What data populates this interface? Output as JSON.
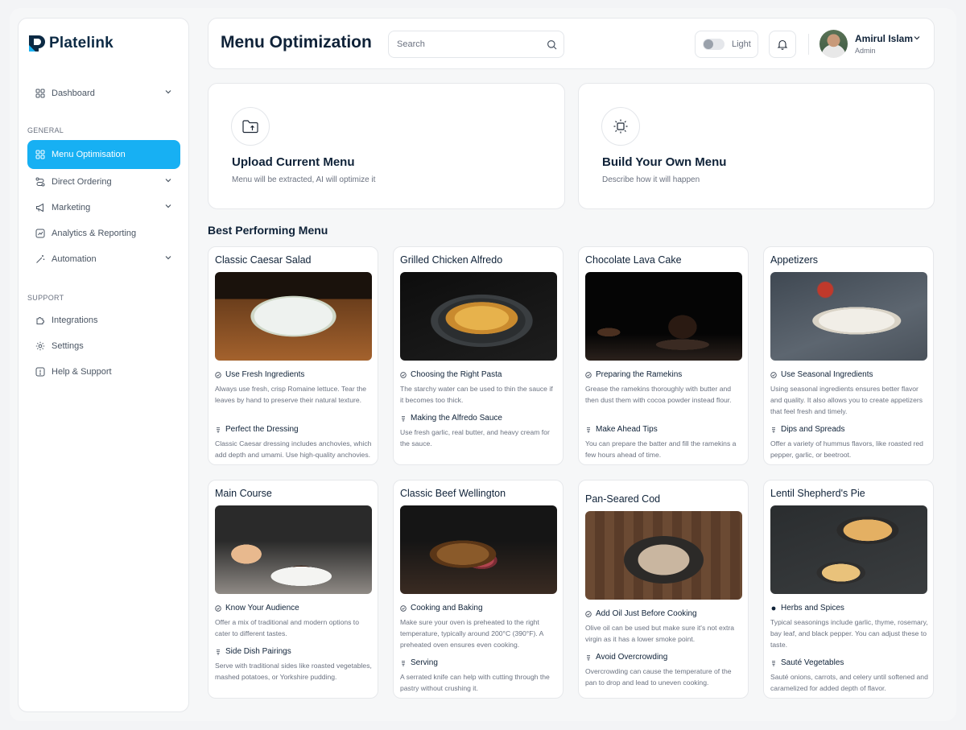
{
  "brand": {
    "name": "Platelink"
  },
  "sidebar": {
    "items": [
      {
        "label": "Dashboard",
        "icon": "grid-icon",
        "has_chevron": true
      },
      {
        "label": "Menu Optimisation",
        "icon": "grid-icon",
        "active": true
      },
      {
        "label": "Direct Ordering",
        "icon": "route-icon",
        "has_chevron": true
      },
      {
        "label": "Marketing",
        "icon": "megaphone-icon",
        "has_chevron": true
      },
      {
        "label": "Analytics & Reporting",
        "icon": "chart-icon"
      },
      {
        "label": "Automation",
        "icon": "magic-wand-icon",
        "has_chevron": true
      },
      {
        "label": "Integrations",
        "icon": "puzzle-icon"
      },
      {
        "label": "Settings",
        "icon": "gear-icon"
      },
      {
        "label": "Help & Support",
        "icon": "help-icon"
      }
    ],
    "sections": {
      "general": "GENERAL",
      "support": "SUPPORT"
    }
  },
  "header": {
    "title": "Menu Optimization",
    "search_placeholder": "Search",
    "theme_label": "Light",
    "user": {
      "name": "Amirul Islam",
      "role": "Admin"
    }
  },
  "actions": [
    {
      "title": "Upload Current Menu",
      "subtitle": "Menu will be extracted, AI will optimize it",
      "icon": "folder-upload-icon"
    },
    {
      "title": "Build Your Own Menu",
      "subtitle": "Describe how it will happen",
      "icon": "focus-frame-icon"
    }
  ],
  "best_performing": {
    "heading": "Best Performing Menu",
    "cards": [
      {
        "title": "Classic Caesar Salad",
        "tips": [
          {
            "icon": "check-circle-icon",
            "title": "Use Fresh Ingredients",
            "text": "Always use fresh, crisp Romaine lettuce. Tear the leaves by hand to preserve their natural texture."
          },
          {
            "icon": "drop-icon",
            "title": "Perfect the Dressing",
            "text": "Classic Caesar dressing includes anchovies, which add depth and umami. Use high-quality anchovies."
          }
        ]
      },
      {
        "title": "Grilled Chicken Alfredo",
        "tips": [
          {
            "icon": "check-circle-icon",
            "title": "Choosing the Right Pasta",
            "text": "The starchy water can be used to thin the sauce if it becomes too thick."
          },
          {
            "icon": "drop-icon",
            "title": "Making the Alfredo Sauce",
            "text": "Use fresh garlic, real butter, and heavy cream for the sauce."
          }
        ]
      },
      {
        "title": "Chocolate Lava Cake",
        "tips": [
          {
            "icon": "check-circle-icon",
            "title": "Preparing the Ramekins",
            "text": "Grease the ramekins thoroughly with butter and then dust them with cocoa powder instead flour."
          },
          {
            "icon": "drop-icon",
            "title": "Make Ahead Tips",
            "text": "You can prepare the batter and fill the ramekins a few hours ahead of time."
          }
        ]
      },
      {
        "title": "Appetizers",
        "tips": [
          {
            "icon": "check-circle-icon",
            "title": "Use Seasonal Ingredients",
            "text": "Using seasonal ingredients ensures better flavor and quality. It also allows you to create appetizers that feel fresh and timely."
          },
          {
            "icon": "drop-icon",
            "title": "Dips and Spreads",
            "text": "Offer a variety of hummus flavors, like roasted red pepper, garlic, or beetroot."
          }
        ]
      },
      {
        "title": "Main Course",
        "tips": [
          {
            "icon": "check-circle-icon",
            "title": "Know Your Audience",
            "text": "Offer a mix of traditional and modern options to cater to different tastes."
          },
          {
            "icon": "drop-icon",
            "title": "Side Dish Pairings",
            "text": "Serve with traditional sides like roasted vegetables, mashed potatoes, or Yorkshire pudding."
          }
        ]
      },
      {
        "title": "Classic Beef Wellington",
        "tips": [
          {
            "icon": "check-circle-icon",
            "title": "Cooking and Baking",
            "text": "Make sure your oven is preheated to the right temperature, typically around 200°C (390°F). A preheated oven ensures even cooking."
          },
          {
            "icon": "drop-icon",
            "title": "Serving",
            "text": "A serrated knife can help with cutting through the pastry without crushing it."
          }
        ]
      },
      {
        "title": "Pan-Seared Cod",
        "tips": [
          {
            "icon": "check-circle-icon",
            "title": "Add Oil Just Before Cooking",
            "text": "Olive oil can be used but make sure it's not extra virgin as it has a lower smoke point."
          },
          {
            "icon": "drop-icon",
            "title": "Avoid Overcrowding",
            "text": "Overcrowding can cause the temperature of the pan to drop and lead to uneven cooking."
          }
        ]
      },
      {
        "title": "Lentil Shepherd's Pie",
        "tips": [
          {
            "icon": "dot-icon",
            "title": "Herbs and Spices",
            "text": "Typical seasonings include garlic, thyme, rosemary, bay leaf, and black pepper. You can adjust these to taste."
          },
          {
            "icon": "drop-icon",
            "title": "Sauté Vegetables",
            "text": "Sauté onions, carrots, and celery until softened and caramelized for added depth of flavor."
          }
        ]
      }
    ]
  },
  "colors": {
    "accent": "#17b0f3",
    "text": "#0f2238",
    "muted": "#6b7280",
    "border": "#e6e8eb"
  }
}
